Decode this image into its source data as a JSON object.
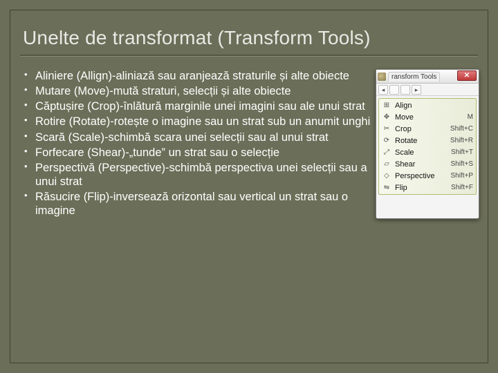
{
  "title": "Unelte de transformat (Transform Tools)",
  "bullets": [
    "Aliniere (Allign)-aliniază sau aranjează straturile și alte obiecte",
    "Mutare (Move)-mută straturi, selecții și alte obiecte",
    "Căptușire (Crop)-înlătură marginile unei imagini sau ale unui strat",
    "Rotire (Rotate)-rotește o imagine sau un strat sub un anumit unghi",
    "Scară (Scale)-schimbă scara unei selecții sau al unui strat",
    "Forfecare (Shear)-„tunde” un strat sau o selecție",
    "Perspectivă (Perspective)-schimbă perspectiva unei selecții sau a unui strat",
    "Răsucire (Flip)-inversează orizontal sau vertical un strat sau o imagine"
  ],
  "panel": {
    "tab_title": "ransform Tools",
    "close_glyph": "✕",
    "menu": [
      {
        "icon": "⊞",
        "label": "Align",
        "ul": "A",
        "shortcut": ""
      },
      {
        "icon": "✥",
        "label": "Move",
        "ul": "M",
        "shortcut": "M"
      },
      {
        "icon": "✂",
        "label": "Crop",
        "ul": "C",
        "shortcut": "Shift+C"
      },
      {
        "icon": "⟳",
        "label": "Rotate",
        "ul": "R",
        "shortcut": "Shift+R"
      },
      {
        "icon": "⤢",
        "label": "Scale",
        "ul": "S",
        "shortcut": "Shift+T"
      },
      {
        "icon": "▱",
        "label": "Shear",
        "ul": "h",
        "shortcut": "Shift+S"
      },
      {
        "icon": "◇",
        "label": "Perspective",
        "ul": "P",
        "shortcut": "Shift+P"
      },
      {
        "icon": "⇋",
        "label": "Flip",
        "ul": "F",
        "shortcut": "Shift+F"
      }
    ]
  }
}
